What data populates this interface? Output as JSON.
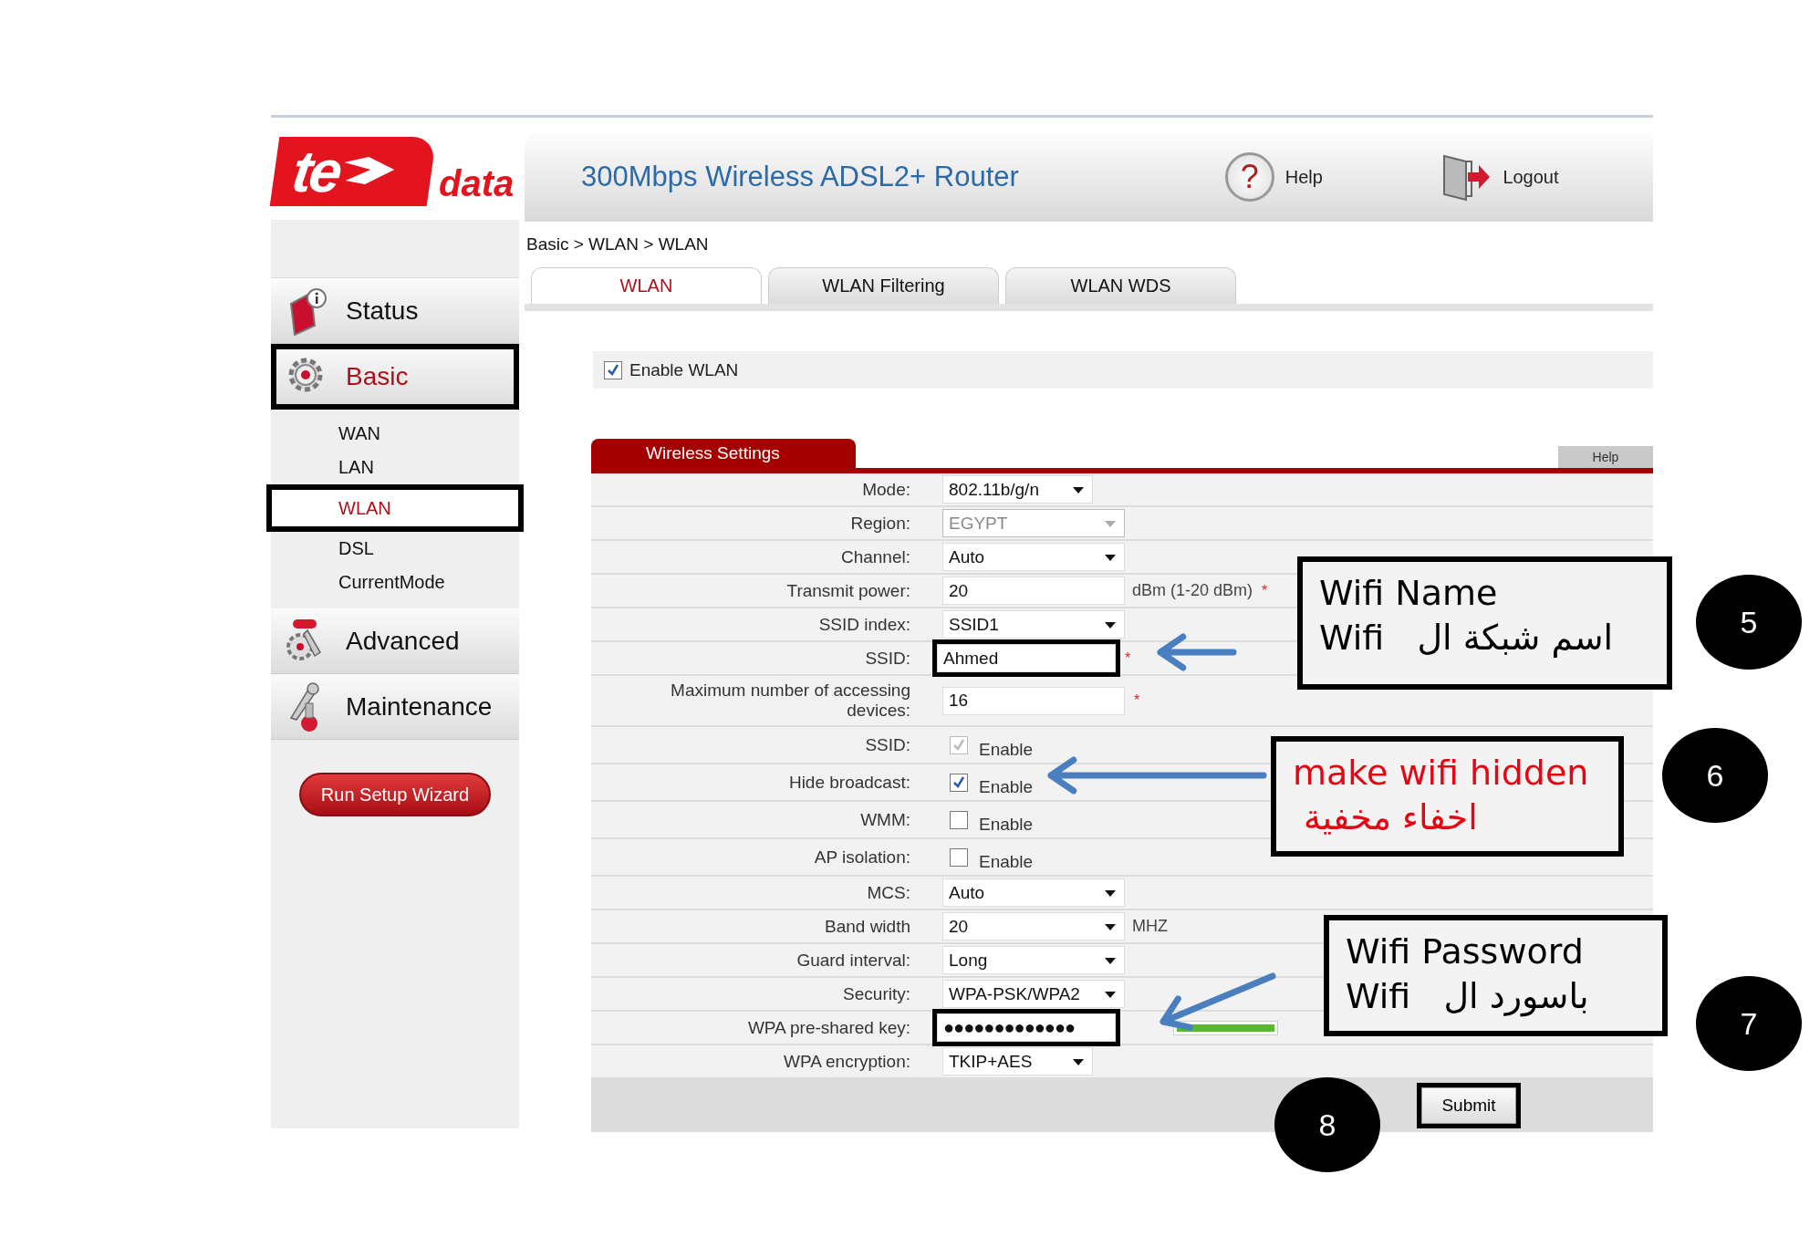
{
  "logo": {
    "text": "te",
    "suffix": "data"
  },
  "header": {
    "title": "300Mbps Wireless ADSL2+ Router",
    "help_glyph": "?",
    "help": "Help",
    "logout": "Logout"
  },
  "breadcrumb": "Basic > WLAN > WLAN",
  "tabs": [
    {
      "label": "WLAN",
      "selected": true
    },
    {
      "label": "WLAN Filtering",
      "selected": false
    },
    {
      "label": "WLAN WDS",
      "selected": false
    }
  ],
  "sidebar": {
    "items": [
      {
        "kind": "status",
        "label": "Status",
        "selected": false,
        "highlighted": false
      },
      {
        "kind": "basic",
        "label": "Basic",
        "selected": true,
        "highlighted": true,
        "children": [
          {
            "label": "WAN",
            "selected": false,
            "highlighted": false
          },
          {
            "label": "LAN",
            "selected": false,
            "highlighted": false
          },
          {
            "label": "WLAN",
            "selected": true,
            "highlighted": true
          },
          {
            "label": "DSL",
            "selected": false,
            "highlighted": false
          },
          {
            "label": "CurrentMode",
            "selected": false,
            "highlighted": false
          }
        ]
      },
      {
        "kind": "advanced",
        "label": "Advanced",
        "selected": false,
        "highlighted": false
      },
      {
        "kind": "maintenance",
        "label": "Maintenance",
        "selected": false,
        "highlighted": false
      }
    ],
    "wizard_button": "Run Setup Wizard"
  },
  "enable_wlan": {
    "label": "Enable WLAN",
    "checked": true
  },
  "section": {
    "title": "Wireless Settings",
    "help": "Help"
  },
  "fields": [
    {
      "kind": "short-select",
      "label": "Mode:",
      "value": "802.11b/g/n",
      "disabled": false
    },
    {
      "kind": "select",
      "label": "Region:",
      "value": "EGYPT",
      "disabled": true
    },
    {
      "kind": "select",
      "label": "Channel:",
      "value": "Auto",
      "disabled": false
    },
    {
      "kind": "text",
      "label": "Transmit power:",
      "value": "20",
      "suffix": "dBm (1-20 dBm)",
      "mark": "*",
      "highlighted": false
    },
    {
      "kind": "select",
      "label": "SSID index:",
      "value": "SSID1",
      "disabled": false
    },
    {
      "kind": "text",
      "label": "SSID:",
      "value": "Ahmed",
      "mark": "*",
      "highlighted": true
    },
    {
      "kind": "text",
      "label": "Maximum number of accessing devices:",
      "value": "16",
      "mark": "*",
      "highlighted": false
    },
    {
      "kind": "checkbox",
      "label": "SSID:",
      "option": "Enable",
      "checked": true,
      "disabled": true
    },
    {
      "kind": "checkbox",
      "label": "Hide broadcast:",
      "option": "Enable",
      "checked": true,
      "disabled": false
    },
    {
      "kind": "checkbox",
      "label": "WMM:",
      "option": "Enable",
      "checked": false,
      "disabled": false
    },
    {
      "kind": "checkbox",
      "label": "AP isolation:",
      "option": "Enable",
      "checked": false,
      "disabled": false
    },
    {
      "kind": "select",
      "label": "MCS:",
      "value": "Auto",
      "disabled": false
    },
    {
      "kind": "select",
      "label": "Band width",
      "value": "20",
      "suffix": "MHZ",
      "disabled": false
    },
    {
      "kind": "select",
      "label": "Guard interval:",
      "value": "Long",
      "disabled": false
    },
    {
      "kind": "select",
      "label": "Security:",
      "value": "WPA-PSK/WPA2",
      "disabled": false
    },
    {
      "kind": "password",
      "label": "WPA pre-shared key:",
      "value": "●●●●●●●●●●●●●",
      "highlighted": true,
      "level": 1
    },
    {
      "kind": "short-select",
      "label": "WPA encryption:",
      "value": "TKIP+AES",
      "disabled": false
    }
  ],
  "submit": {
    "label": "Submit",
    "highlighted": true
  },
  "annotations": [
    {
      "lines": [
        "Wifi Name",
        "Wifi   اسم شبكة ال"
      ],
      "color": "#000000"
    },
    {
      "lines": [
        "make wifi hidden",
        " اخفاء مخفية"
      ],
      "color": "#e30613"
    },
    {
      "lines": [
        "Wifi Password",
        "Wifi   باسورد ال"
      ],
      "color": "#000000"
    }
  ],
  "callouts": [
    "5",
    "6",
    "7",
    "8"
  ]
}
